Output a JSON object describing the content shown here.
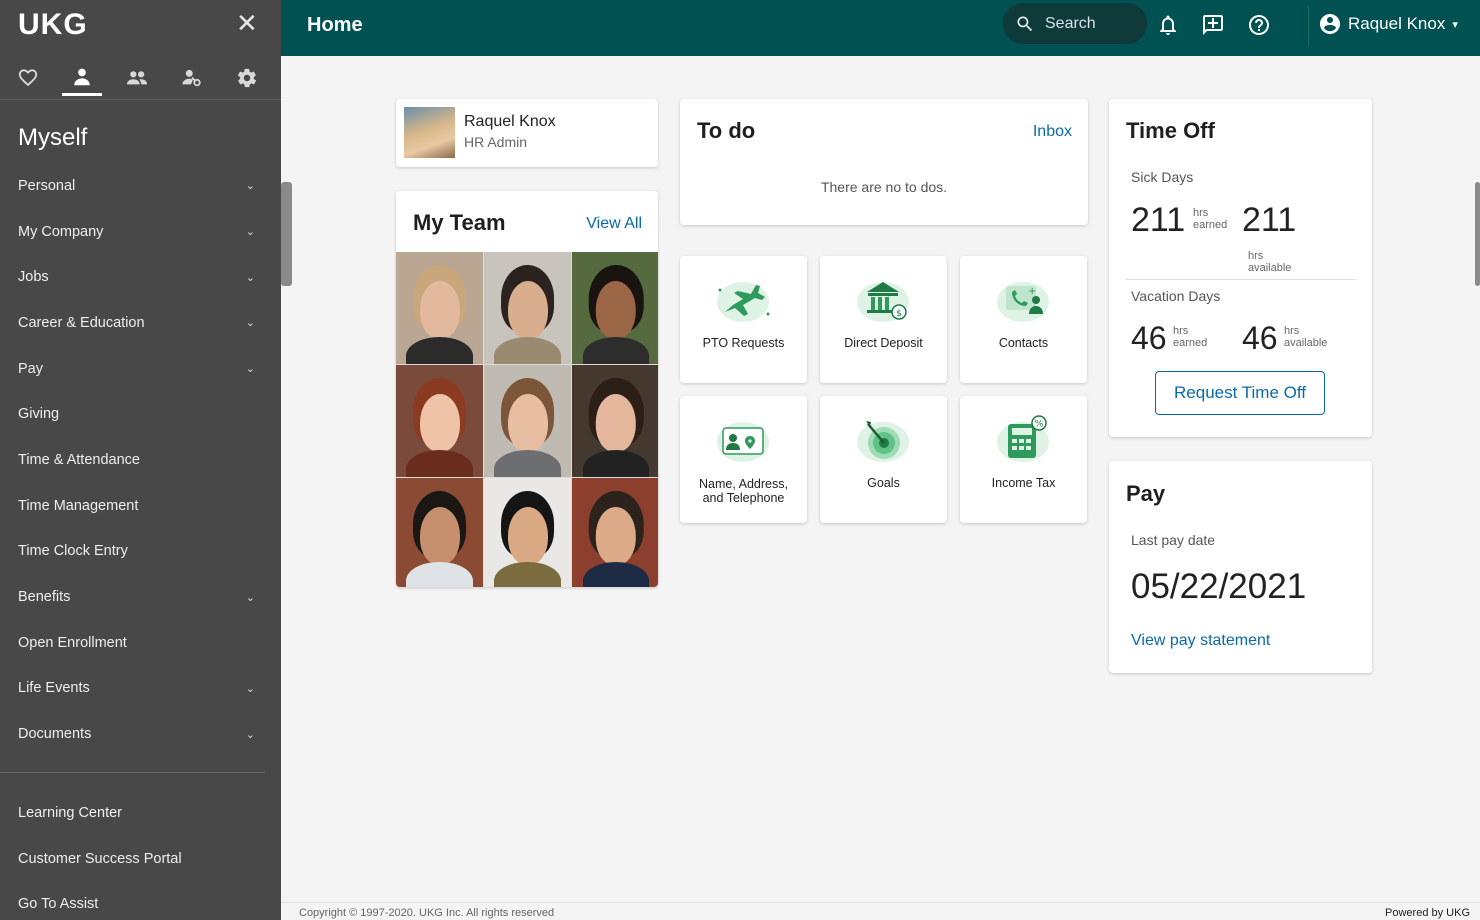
{
  "sidebar": {
    "logo": "UKG",
    "close": "✕",
    "section_title": "Myself",
    "tabs": [
      {
        "name": "favorites",
        "icon": "heart-icon"
      },
      {
        "name": "myself",
        "icon": "person-icon"
      },
      {
        "name": "team",
        "icon": "people-icon"
      },
      {
        "name": "admin",
        "icon": "person-key-icon"
      },
      {
        "name": "settings",
        "icon": "gear-icon"
      }
    ],
    "items": [
      {
        "label": "Personal",
        "chevron": "⌄"
      },
      {
        "label": "My Company",
        "chevron": "⌄"
      },
      {
        "label": "Jobs",
        "chevron": "⌄"
      },
      {
        "label": "Career & Education",
        "chevron": "⌄"
      },
      {
        "label": "Pay",
        "chevron": "⌄"
      },
      {
        "label": "Giving",
        "chevron": ""
      },
      {
        "label": "Time & Attendance",
        "chevron": ""
      },
      {
        "label": "Time Management",
        "chevron": ""
      },
      {
        "label": "Time Clock Entry",
        "chevron": ""
      },
      {
        "label": "Benefits",
        "chevron": "⌄"
      },
      {
        "label": "Open Enrollment",
        "chevron": ""
      },
      {
        "label": "Life Events",
        "chevron": "⌄"
      },
      {
        "label": "Documents",
        "chevron": "⌄"
      }
    ],
    "bottom_items": [
      {
        "label": "Learning Center"
      },
      {
        "label": "Customer Success Portal"
      },
      {
        "label": "Go To Assist"
      }
    ]
  },
  "header": {
    "title": "Home",
    "search_label": "Search",
    "user_name": "Raquel Knox",
    "caret": "▾"
  },
  "profile": {
    "name": "Raquel Knox",
    "role": "HR Admin"
  },
  "team": {
    "title": "My Team",
    "view_all": "View All"
  },
  "todo": {
    "title": "To do",
    "inbox": "Inbox",
    "empty": "There are no to dos."
  },
  "tiles": [
    {
      "label": "PTO Requests",
      "icon": "airplane-icon"
    },
    {
      "label": "Direct Deposit",
      "icon": "bank-icon"
    },
    {
      "label": "Contacts",
      "icon": "contact-phone-icon"
    },
    {
      "label": "Name, Address, and Telephone",
      "icon": "id-card-icon"
    },
    {
      "label": "Goals",
      "icon": "target-icon"
    },
    {
      "label": "Income Tax",
      "icon": "calculator-icon"
    }
  ],
  "time_off": {
    "title": "Time Off",
    "sick_label": "Sick Days",
    "sick_earned": "211",
    "sick_available": "211",
    "vac_label": "Vacation Days",
    "vac_earned": "46",
    "vac_available": "46",
    "hrs": "hrs",
    "earned": "earned",
    "available": "available",
    "button": "Request Time Off"
  },
  "pay": {
    "title": "Pay",
    "last_pay_label": "Last pay date",
    "last_pay_date": "05/22/2021",
    "view_statement": "View pay statement"
  },
  "footer": {
    "copyright": "Copyright © 1997-2020. UKG Inc. All rights reserved",
    "powered": "Powered by UKG"
  },
  "colors": {
    "topbar": "#005151",
    "sidebar": "#484848",
    "accent_link": "#0a6aa8",
    "illustration_green": "#2e9a5c"
  }
}
